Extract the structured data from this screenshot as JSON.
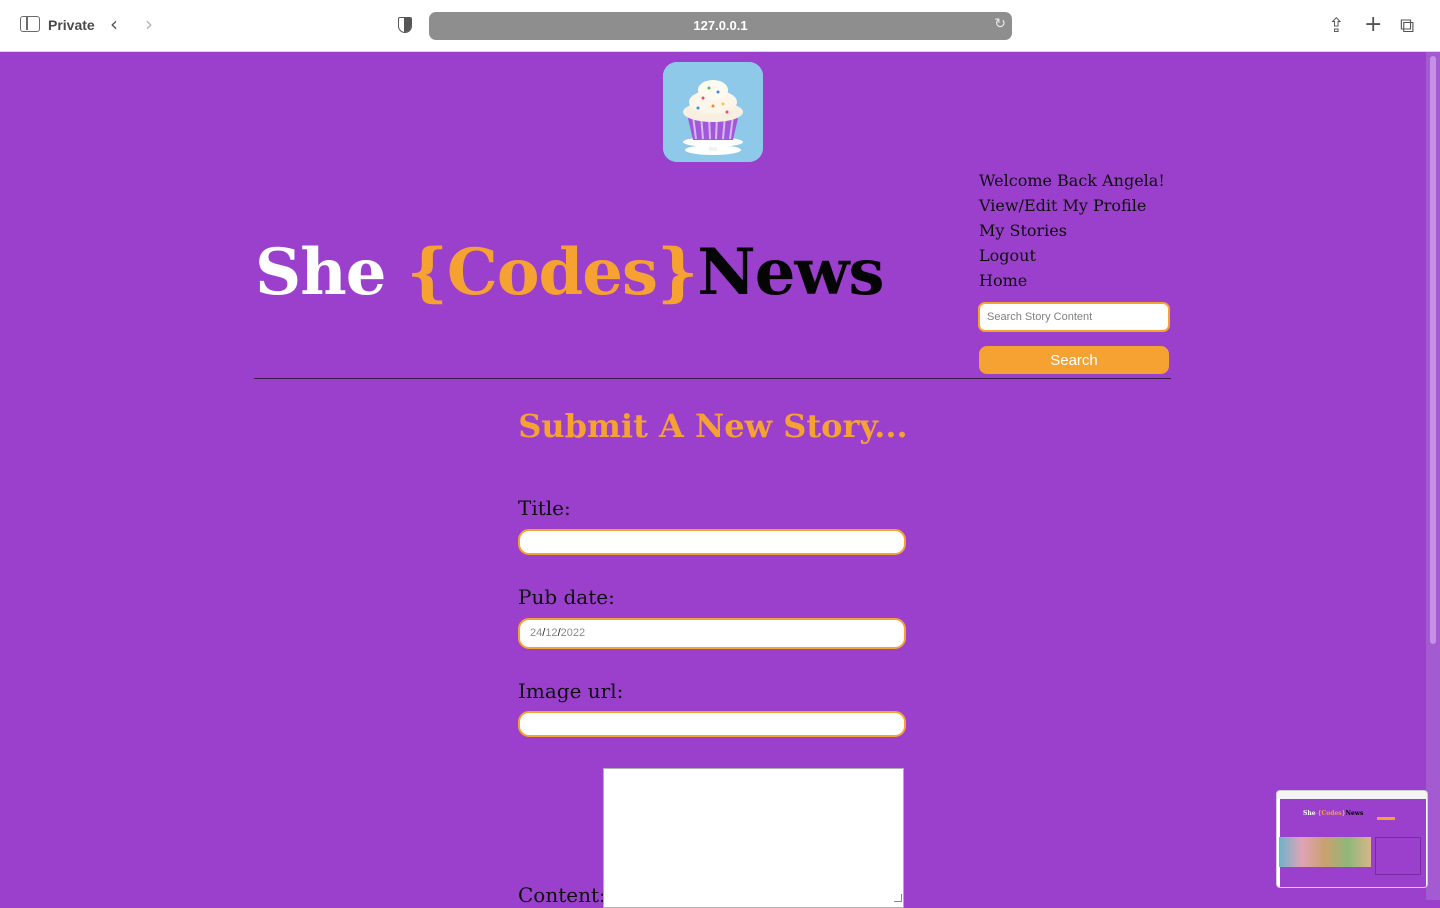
{
  "browser": {
    "private_label": "Private",
    "url": "127.0.0.1"
  },
  "header": {
    "title_part1": "She ",
    "title_part2": "{Codes}",
    "title_part3": "News",
    "logo_icon": "cupcake-icon"
  },
  "user_menu": {
    "welcome": "Welcome Back Angela!",
    "profile": "View/Edit My Profile",
    "stories": "My Stories",
    "logout": "Logout",
    "home": "Home"
  },
  "search": {
    "placeholder": "Search Story Content",
    "button_label": "Search"
  },
  "form": {
    "heading": "Submit A New Story...",
    "title_label": "Title:",
    "title_value": "",
    "pub_date_label": "Pub date:",
    "pub_date_day": "24",
    "pub_date_month": "12",
    "pub_date_year": "2022",
    "date_separator": "/",
    "image_url_label": "Image url:",
    "image_url_value": "",
    "content_label": "Content:"
  },
  "colors": {
    "background": "#9b40cc",
    "accent": "#f5a233",
    "title_white": "#ffffff",
    "title_black": "#050505"
  }
}
